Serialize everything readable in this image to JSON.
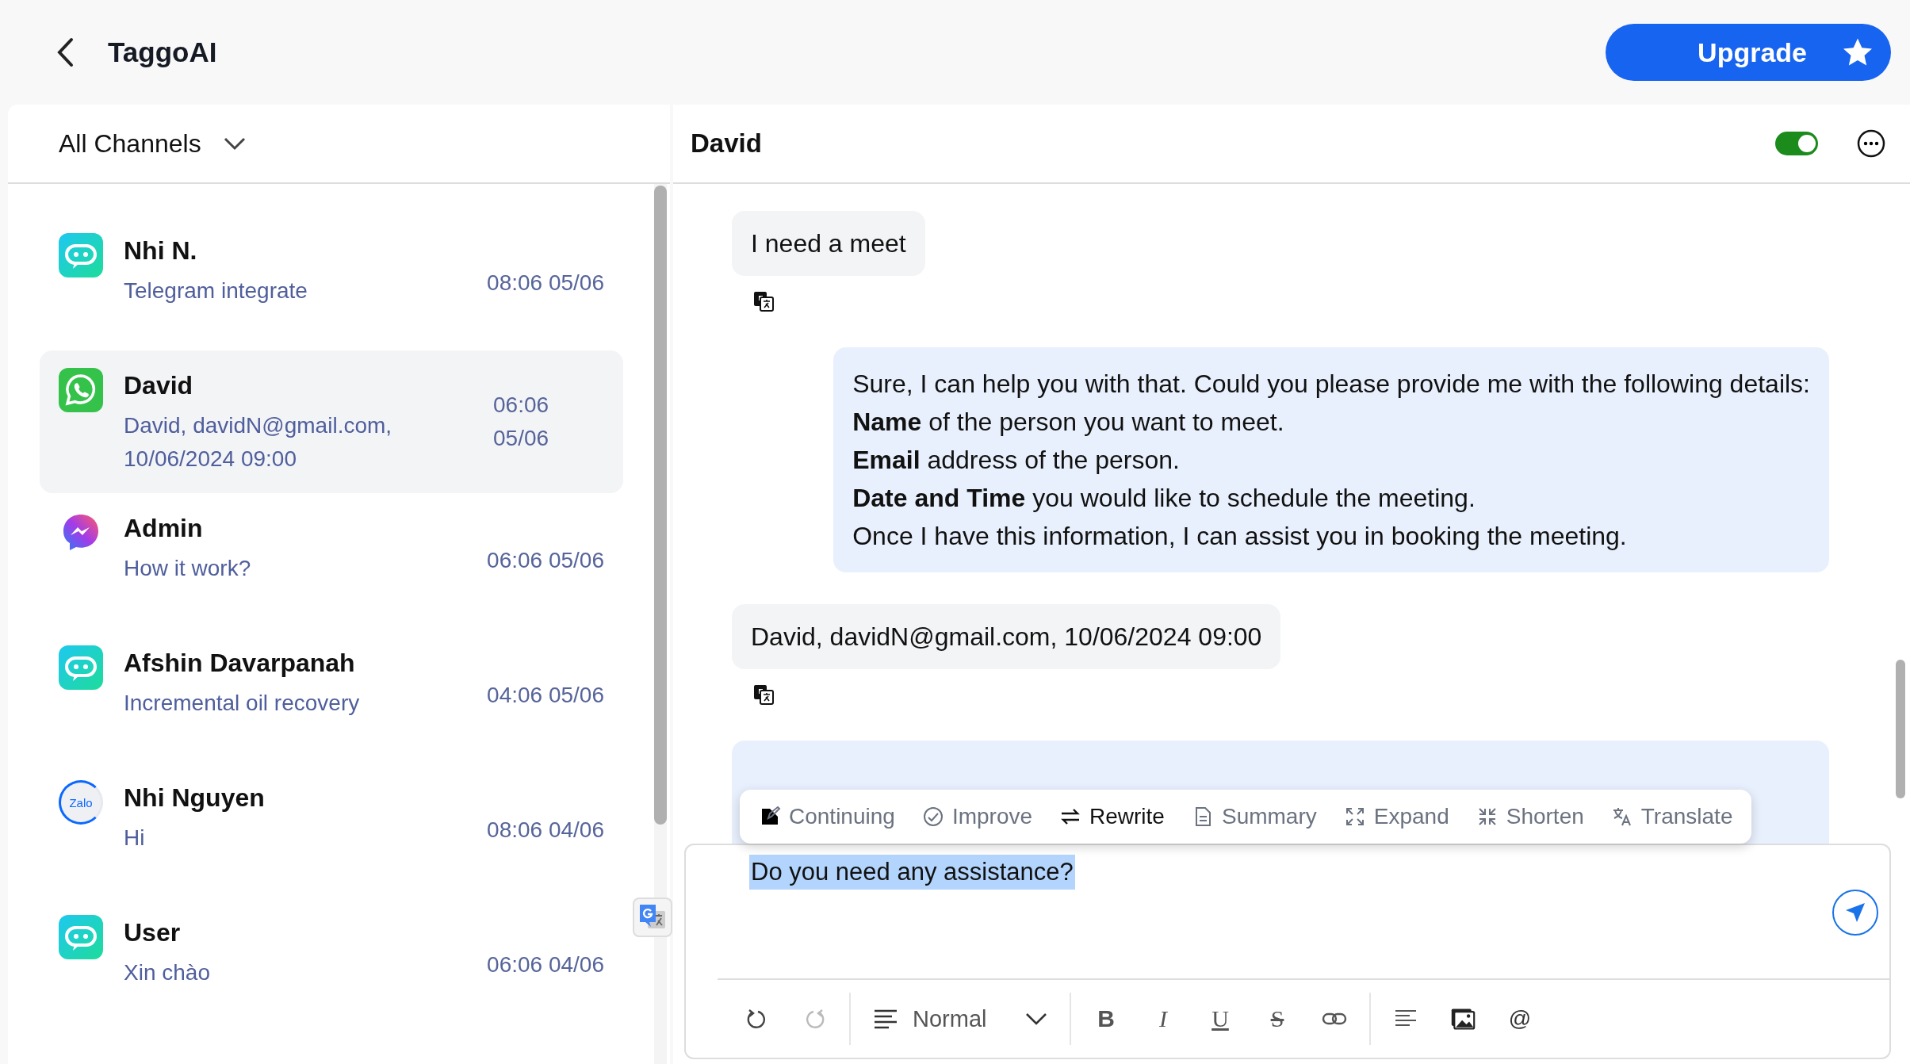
{
  "app": {
    "title": "TaggoAI"
  },
  "upgrade": {
    "label": "Upgrade"
  },
  "sidebar": {
    "filter": "All Channels",
    "conversations": [
      {
        "name": "Nhi N.",
        "preview": "Telegram integrate",
        "time": "08:06 05/06",
        "kind": "bot",
        "selected": false
      },
      {
        "name": "David",
        "preview": "David, davidN@gmail.com, 10/06/2024 09:00",
        "time": "06:06 05/06",
        "kind": "whatsapp",
        "selected": true
      },
      {
        "name": "Admin",
        "preview": "How it work?",
        "time": "06:06 05/06",
        "kind": "messenger",
        "selected": false
      },
      {
        "name": "Afshin Davarpanah",
        "preview": "Incremental oil recovery",
        "time": "04:06 05/06",
        "kind": "bot",
        "selected": false
      },
      {
        "name": "Nhi Nguyen",
        "preview": "Hi",
        "time": "08:06 04/06",
        "kind": "zalo",
        "logo_text": "Zalo",
        "selected": false
      },
      {
        "name": "User",
        "preview": "Xin chào",
        "time": "06:06 04/06",
        "kind": "bot",
        "selected": false
      }
    ]
  },
  "chat": {
    "contact": "David",
    "bot_enabled": true,
    "messages": [
      {
        "kind": "user",
        "lines": [
          "I need a meet"
        ],
        "translate": true
      },
      {
        "kind": "bot",
        "lines": [
          "Sure, I can help you with that. Could you please provide me with the following details:",
          "**Name** of the person you want to meet.",
          "**Email** address of the person.",
          "**Date and Time** you would like to schedule the meeting.",
          "Once I have this information, I can assist you in booking the meeting."
        ],
        "translate": false
      },
      {
        "kind": "user",
        "lines": [
          "David, davidN@gmail.com, 10/06/2024 09:00"
        ],
        "translate": true
      }
    ],
    "ai_actions": [
      {
        "label": "Continuing",
        "kind": "continue",
        "selected": false
      },
      {
        "label": "Improve",
        "kind": "improve",
        "selected": false
      },
      {
        "label": "Rewrite",
        "kind": "rewrite",
        "selected": true
      },
      {
        "label": "Summary",
        "kind": "summary",
        "selected": false
      },
      {
        "label": "Expand",
        "kind": "expand",
        "selected": false
      },
      {
        "label": "Shorten",
        "kind": "shorten",
        "selected": false
      },
      {
        "label": "Translate",
        "kind": "translate",
        "selected": false
      }
    ],
    "composer": {
      "value": "Do you need any assistance?",
      "text_selected": true,
      "block_style": "Normal",
      "format": [
        {
          "kind": "bold",
          "label": "B"
        },
        {
          "kind": "italic",
          "label": "I"
        },
        {
          "kind": "underline",
          "label": "U"
        },
        {
          "kind": "strike",
          "label": "S"
        }
      ],
      "mention": "@"
    }
  }
}
